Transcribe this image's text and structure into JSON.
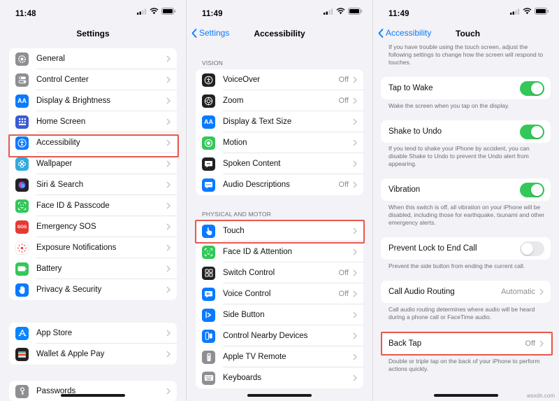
{
  "panel1": {
    "time": "11:48",
    "title": "Settings",
    "groups": [
      [
        {
          "label": "General",
          "icon": "gear-icon",
          "color": "#8e8e93"
        },
        {
          "label": "Control Center",
          "icon": "toggles-icon",
          "color": "#8e8e93"
        },
        {
          "label": "Display & Brightness",
          "icon": "aa-icon",
          "color": "#0a7aff"
        },
        {
          "label": "Home Screen",
          "icon": "home-grid-icon",
          "color": "#3c5bd6"
        },
        {
          "label": "Accessibility",
          "icon": "accessibility-icon",
          "color": "#0a7aff"
        },
        {
          "label": "Wallpaper",
          "icon": "flower-icon",
          "color": "#35aadc"
        },
        {
          "label": "Siri & Search",
          "icon": "siri-icon",
          "color": "#222222"
        },
        {
          "label": "Face ID & Passcode",
          "icon": "face-id-icon",
          "color": "#34c759"
        },
        {
          "label": "Emergency SOS",
          "icon": "sos-icon",
          "color": "#e53935"
        },
        {
          "label": "Exposure Notifications",
          "icon": "exposure-icon",
          "color": "#ffffff"
        },
        {
          "label": "Battery",
          "icon": "battery-icon",
          "color": "#34c759"
        },
        {
          "label": "Privacy & Security",
          "icon": "hand-icon",
          "color": "#0a7aff"
        }
      ],
      [
        {
          "label": "App Store",
          "icon": "app-store-icon",
          "color": "#0a84ff"
        },
        {
          "label": "Wallet & Apple Pay",
          "icon": "wallet-icon",
          "color": "#222222"
        }
      ],
      [
        {
          "label": "Passwords",
          "icon": "key-icon",
          "color": "#8e8e93"
        }
      ]
    ]
  },
  "panel2": {
    "time": "11:49",
    "back": "Settings",
    "title": "Accessibility",
    "section_vision": "VISION",
    "section_physical": "PHYSICAL AND MOTOR",
    "vision": [
      {
        "label": "VoiceOver",
        "value": "Off",
        "icon": "voiceover-icon",
        "color": "#222222"
      },
      {
        "label": "Zoom",
        "value": "Off",
        "icon": "zoom-icon",
        "color": "#222222"
      },
      {
        "label": "Display & Text Size",
        "value": "",
        "icon": "aa-icon",
        "color": "#0a7aff"
      },
      {
        "label": "Motion",
        "value": "",
        "icon": "motion-icon",
        "color": "#34c759"
      },
      {
        "label": "Spoken Content",
        "value": "",
        "icon": "spoken-content-icon",
        "color": "#222222"
      },
      {
        "label": "Audio Descriptions",
        "value": "Off",
        "icon": "audio-description-icon",
        "color": "#0a7aff"
      }
    ],
    "physical": [
      {
        "label": "Touch",
        "value": "",
        "icon": "touch-hand-icon",
        "color": "#0a7aff"
      },
      {
        "label": "Face ID & Attention",
        "value": "",
        "icon": "face-id-icon",
        "color": "#34c759"
      },
      {
        "label": "Switch Control",
        "value": "Off",
        "icon": "switch-control-icon",
        "color": "#222222"
      },
      {
        "label": "Voice Control",
        "value": "Off",
        "icon": "voice-control-icon",
        "color": "#0a7aff"
      },
      {
        "label": "Side Button",
        "value": "",
        "icon": "side-button-icon",
        "color": "#0a7aff"
      },
      {
        "label": "Control Nearby Devices",
        "value": "",
        "icon": "nearby-devices-icon",
        "color": "#0a7aff"
      },
      {
        "label": "Apple TV Remote",
        "value": "",
        "icon": "remote-icon",
        "color": "#8e8e93"
      },
      {
        "label": "Keyboards",
        "value": "",
        "icon": "keyboard-icon",
        "color": "#8e8e93"
      }
    ]
  },
  "panel3": {
    "time": "11:49",
    "back": "Accessibility",
    "title": "Touch",
    "intro": "If you have trouble using the touch screen, adjust the following settings to change how the screen will respond to touches.",
    "tap_to_wake": {
      "label": "Tap to Wake",
      "state": "on",
      "note": "Wake the screen when you tap on the display."
    },
    "shake_to_undo": {
      "label": "Shake to Undo",
      "state": "on",
      "note": "If you tend to shake your iPhone by accident, you can disable Shake to Undo to prevent the Undo alert from appearing."
    },
    "vibration": {
      "label": "Vibration",
      "state": "on",
      "note": "When this switch is off, all vibration on your iPhone will be disabled, including those for earthquake, tsunami and other emergency alerts."
    },
    "prevent_lock": {
      "label": "Prevent Lock to End Call",
      "state": "off",
      "note": "Prevent the side button from ending the current call."
    },
    "call_audio": {
      "label": "Call Audio Routing",
      "value": "Automatic",
      "note": "Call audio routing determines where audio will be heard during a phone call or FaceTime audio."
    },
    "back_tap": {
      "label": "Back Tap",
      "value": "Off",
      "note": "Double or triple tap on the back of your iPhone to perform actions quickly."
    }
  },
  "colors": {
    "accent": "#0a7aff",
    "highlight": "#e8584d",
    "toggle_on": "#34c759"
  },
  "watermark": "wsxdn.com"
}
